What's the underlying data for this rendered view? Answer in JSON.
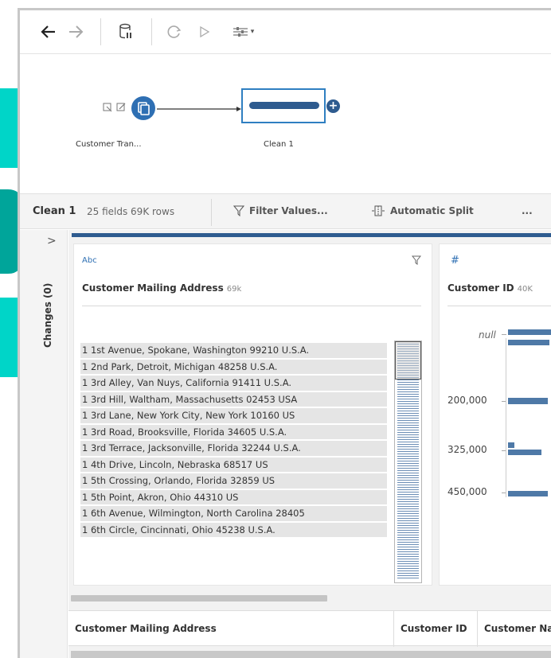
{
  "colors": {
    "accent": "#2e5b8f",
    "teal": "#00d5c8",
    "teal_dark": "#00a59a",
    "bar": "#4e79a7",
    "selection": "#2f7fc1"
  },
  "toolbar": {
    "icons": [
      "back-arrow-icon",
      "forward-arrow-icon",
      "pause-data-icon",
      "refresh-icon",
      "run-flow-icon",
      "settings-sliders-icon"
    ],
    "dropdown_glyph": "▾"
  },
  "flow": {
    "input_node_label": "Customer Tran...",
    "clean_node_label": "Clean 1",
    "add_step_glyph": "+"
  },
  "profile_bar": {
    "step_name": "Clean 1",
    "meta": "25 fields  69K rows",
    "filter_label": "Filter Values...",
    "split_label": "Automatic Split",
    "more_label": "..."
  },
  "left_strip": {
    "expand_glyph": ">",
    "changes_label": "Changes (0)"
  },
  "cards": {
    "address": {
      "type": "Abc",
      "name": "Customer Mailing Address",
      "count": "69k",
      "values": [
        "1 1st Avenue, Spokane, Washington 99210 U.S.A.",
        "1 2nd Park, Detroit, Michigan 48258 U.S.A.",
        "1 3rd Alley, Van Nuys, California 91411 U.S.A.",
        "1 3rd Hill, Waltham, Massachusetts 02453 USA",
        "1 3rd Lane, New York City, New York 10160 US",
        "1 3rd Road, Brooksville, Florida 34605 U.S.A.",
        "1 3rd Terrace, Jacksonville, Florida 32244 U.S.A.",
        "1 4th Drive, Lincoln, Nebraska 68517 US",
        "1 5th Crossing, Orlando, Florida 32859 US",
        "1 5th Point, Akron, Ohio 44310 US",
        "1 6th Avenue, Wilmington, North Carolina 28405",
        "1 6th Circle, Cincinnati, Ohio 45238 U.S.A."
      ]
    },
    "customer_id": {
      "type": "#",
      "name": "Customer ID",
      "count": "40K",
      "axis": [
        "null",
        "200,000",
        "325,000",
        "450,000"
      ]
    }
  },
  "grid": {
    "columns": [
      "Customer Mailing Address",
      "Customer ID",
      "Customer Name"
    ]
  }
}
